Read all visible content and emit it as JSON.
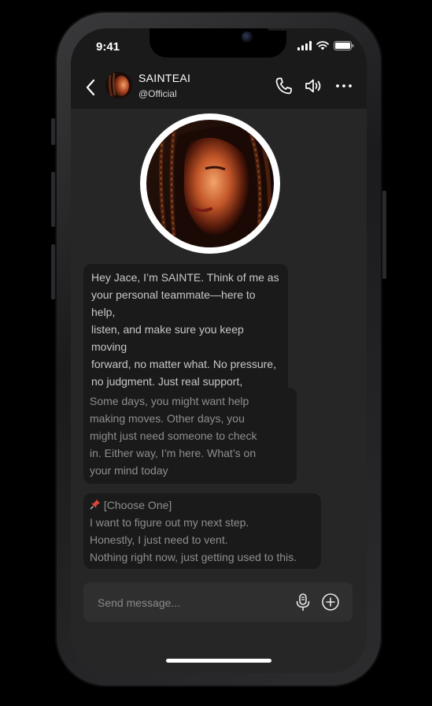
{
  "status_bar": {
    "time": "9:41"
  },
  "header": {
    "contact_name": "SAINTEAI",
    "contact_handle": "@Official"
  },
  "messages": {
    "intro": "Hey Jace, I’m SAINTE. Think of me as\nyour personal teammate—here to help,\nlisten, and make sure you keep moving\nforward, no matter what. No pressure,\nno judgment. Just real support,\nwhenever you need it.",
    "followup": "Some days, you might want help\nmaking moves. Other days, you\nmight just need someone to check\nin. Either way, I’m here. What’s on\nyour mind today",
    "choice_prompt": "[Choose One]",
    "options": [
      "I want to figure out my next step.",
      "Honestly, I just need to vent.",
      "Nothing right now, just getting used to this."
    ]
  },
  "composer": {
    "placeholder": "Send message..."
  },
  "icons": {
    "back": "chevron-left-icon",
    "call": "phone-icon",
    "speaker": "speaker-icon",
    "more": "more-horizontal-icon",
    "mic": "microphone-icon",
    "add": "plus-circle-icon",
    "pin": "pushpin-icon"
  },
  "colors": {
    "screen_bg": "#262626",
    "bubble_bg": "#1a1a1a",
    "text_primary": "#c8c8c8",
    "text_muted": "#8e8e8e",
    "pin": "#e0453a"
  }
}
